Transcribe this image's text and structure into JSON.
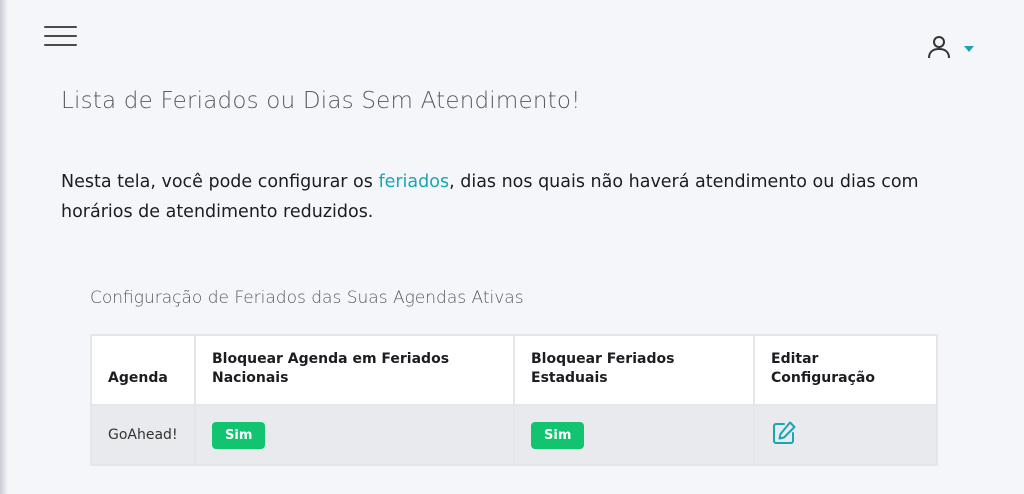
{
  "header": {
    "menu_icon": "hamburger-menu-icon",
    "user_icon": "user-icon",
    "dropdown_icon": "caret-down-icon",
    "accent_color": "#1aa5b4"
  },
  "page": {
    "title": "Lista de Feriados ou Dias Sem Atendimento!",
    "intro_before": "Nesta tela, você pode configurar os ",
    "intro_link": "feriados",
    "intro_after": ", dias nos quais não haverá atendimento ou dias com horários de atendimento reduzidos."
  },
  "section": {
    "title": "Configuração de Feriados das Suas Agendas Ativas"
  },
  "table": {
    "columns": [
      "Agenda",
      "Bloquear Agenda em Feriados Nacionais",
      "Bloquear Feriados Estaduais",
      "Editar Configuração"
    ],
    "rows": [
      {
        "agenda": "GoAhead!",
        "nacionais": "Sim",
        "estaduais": "Sim",
        "edit_icon": "edit-icon"
      }
    ],
    "badge_color": "#12c46f"
  }
}
